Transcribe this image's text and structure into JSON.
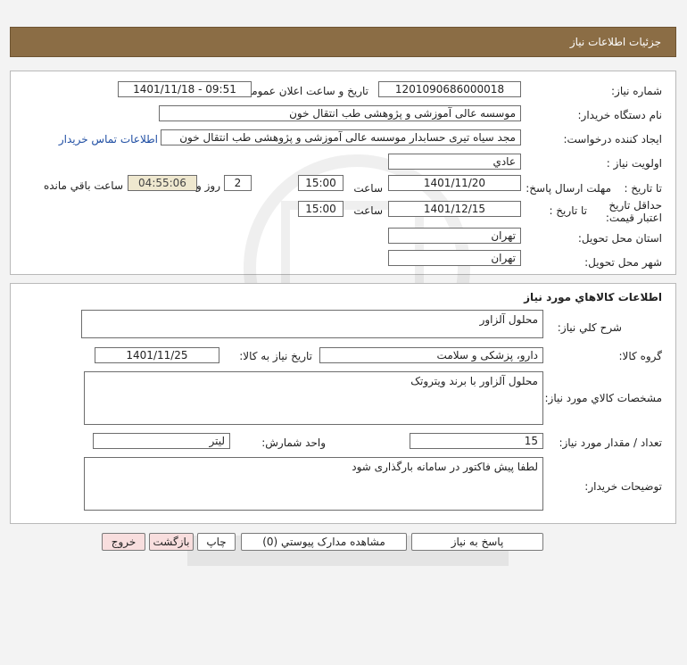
{
  "header": {
    "title": "جزئیات اطلاعات نیاز"
  },
  "details": {
    "need_number_label": "شماره نیاز:",
    "need_number": "1201090686000018",
    "announce_label": "تاریخ و ساعت اعلان عمومی:",
    "announce_value": "1401/11/18 - 09:51",
    "buyer_org_label": "نام دستگاه خریدار:",
    "buyer_org": "موسسه عالی آموزشی و پژوهشی طب انتقال خون",
    "requester_label": "ایجاد کننده درخواست:",
    "requester": "مجد سیاه تیری حسابدار موسسه عالی آموزشی و پژوهشی طب انتقال خون",
    "contact_link": "اطلاعات تماس خریدار",
    "priority_label": "اولویت نیاز :",
    "priority": "عادي",
    "deadline_label": "مهلت ارسال پاسخ:",
    "until_date_label": "تا تاریخ :",
    "deadline_date": "1401/11/20",
    "time_label": "ساعت",
    "deadline_time": "15:00",
    "days_value": "2",
    "days_label": "روز و",
    "remaining_time": "04:55:06",
    "remaining_label": "ساعت باقي مانده",
    "validity_label": "حداقل تاریخ اعتبار قیمت:",
    "validity_until_label": "تا تاریخ :",
    "validity_date": "1401/12/15",
    "validity_time_label": "ساعت",
    "validity_time": "15:00",
    "province_label": "استان محل تحویل:",
    "province": "تهران",
    "city_label": "شهر محل تحویل:",
    "city": "تهران"
  },
  "goods": {
    "section_title": "اطلاعات کالاهاي مورد نياز",
    "general_desc_label": "شرح کلي نياز:",
    "general_desc": "محلول آلزاور",
    "group_label": "گروه کالا:",
    "group": "دارو، پزشکی و سلامت",
    "need_date_label": "تاریخ نیاز به کالا:",
    "need_date": "1401/11/25",
    "specs_label": "مشخصات کالاي مورد نياز:",
    "specs": "محلول آلزاور با برند ویتروتک",
    "qty_label": "تعداد / مقدار مورد نیاز:",
    "qty": "15",
    "unit_label": "واحد شمارش:",
    "unit": "لیتر",
    "buyer_notes_label": "توضيحات خريدار:",
    "buyer_notes": "لطفا پیش فاکتور در سامانه بارگذاری شود"
  },
  "buttons": {
    "reply": "پاسخ به نياز",
    "attachments": "مشاهده مدارک پيوستي (0)",
    "print": "چاپ",
    "back": "بازگشت",
    "exit": "خروج"
  }
}
